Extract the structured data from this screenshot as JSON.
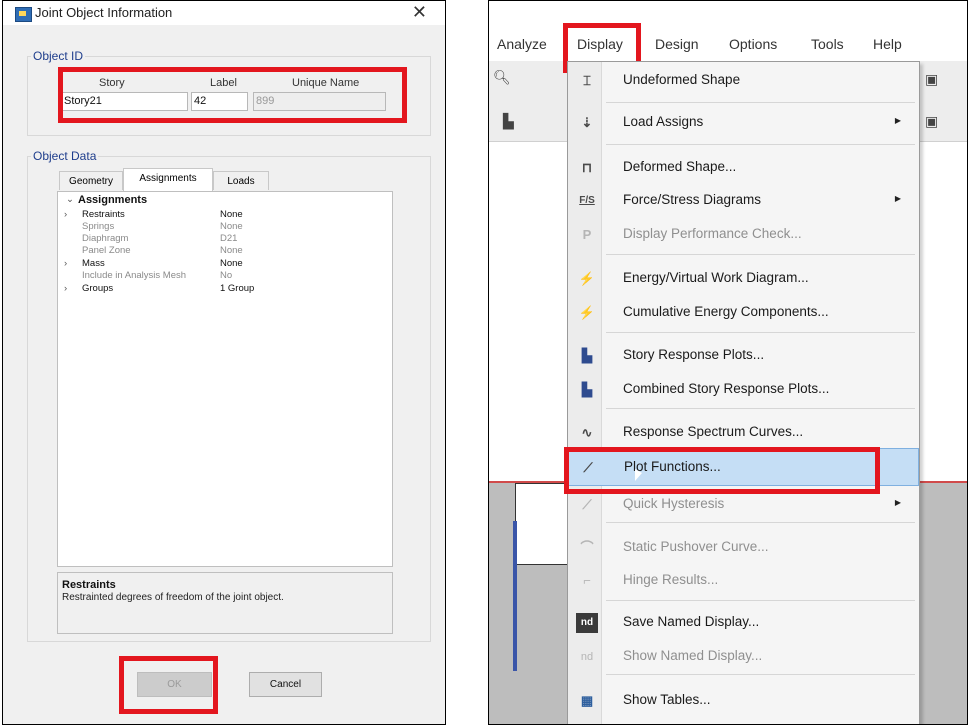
{
  "dialog": {
    "title": "Joint Object Information",
    "close_glyph": "✕",
    "object_id": {
      "group_title": "Object ID",
      "col_story": "Story",
      "col_label": "Label",
      "col_unique": "Unique Name",
      "story_value": "Story21",
      "label_value": "42",
      "unique_value": "899"
    },
    "object_data": {
      "group_title": "Object Data",
      "tabs": [
        "Geometry",
        "Assignments",
        "Loads"
      ],
      "active_tab": "Assignments",
      "section_title": "Assignments",
      "rows": [
        {
          "key": "Restraints",
          "value": "None"
        },
        {
          "key": "Springs",
          "value": "None"
        },
        {
          "key": "Diaphragm",
          "value": "D21"
        },
        {
          "key": "Panel Zone",
          "value": "None"
        },
        {
          "key": "Mass",
          "value": "None"
        },
        {
          "key": "Include in Analysis Mesh",
          "value": "No"
        },
        {
          "key": "Groups",
          "value": "1 Group"
        }
      ]
    },
    "description": {
      "title": "Restraints",
      "text": "Restrainted degrees of freedom of the joint object."
    },
    "buttons": {
      "ok": "OK",
      "cancel": "Cancel"
    }
  },
  "app": {
    "menubar": [
      "Analyze",
      "Display",
      "Design",
      "Options",
      "Tools",
      "Help"
    ],
    "active_menu": "Display",
    "menu_items": [
      {
        "label": "Undeformed Shape",
        "icon": "undeformed-shape-icon",
        "glyph": "⌶"
      },
      {
        "label": "Load Assigns",
        "icon": "load-assigns-icon",
        "glyph": "⇣",
        "submenu": true
      },
      {
        "label": "Deformed Shape...",
        "icon": "deformed-shape-icon",
        "glyph": "⊓"
      },
      {
        "label": "Force/Stress Diagrams",
        "icon": "force-stress-icon",
        "glyph": "F/S",
        "submenu": true
      },
      {
        "label": "Display Performance Check...",
        "icon": "performance-check-icon",
        "glyph": "P",
        "disabled": true
      },
      {
        "label": "Energy/Virtual Work Diagram...",
        "icon": "energy-diagram-icon",
        "glyph": "⚡"
      },
      {
        "label": "Cumulative Energy Components...",
        "icon": "cumulative-energy-icon",
        "glyph": "⚡"
      },
      {
        "label": "Story Response Plots...",
        "icon": "story-response-icon",
        "glyph": "▙"
      },
      {
        "label": "Combined Story Response Plots...",
        "icon": "combined-story-response-icon",
        "glyph": "▙"
      },
      {
        "label": "Response Spectrum Curves...",
        "icon": "response-spectrum-icon",
        "glyph": "∿"
      },
      {
        "label": "Plot Functions...",
        "icon": "plot-functions-icon",
        "glyph": "⟋",
        "highlight": true
      },
      {
        "label": "Quick Hysteresis",
        "icon": "quick-hysteresis-icon",
        "glyph": "⟋",
        "submenu": true,
        "disabled": true
      },
      {
        "label": "Static Pushover Curve...",
        "icon": "pushover-curve-icon",
        "glyph": "⌒",
        "disabled": true
      },
      {
        "label": "Hinge Results...",
        "icon": "hinge-results-icon",
        "glyph": "⌐",
        "disabled": true
      },
      {
        "label": "Save Named Display...",
        "icon": "save-named-display-icon",
        "glyph": "nd"
      },
      {
        "label": "Show Named Display...",
        "icon": "show-named-display-icon",
        "glyph": "nd",
        "disabled": true
      },
      {
        "label": "Show Tables...",
        "icon": "show-tables-icon",
        "glyph": "▦"
      }
    ]
  },
  "colors": {
    "highlight_box": "#e3161e",
    "menu_hover": "#c5def5"
  }
}
